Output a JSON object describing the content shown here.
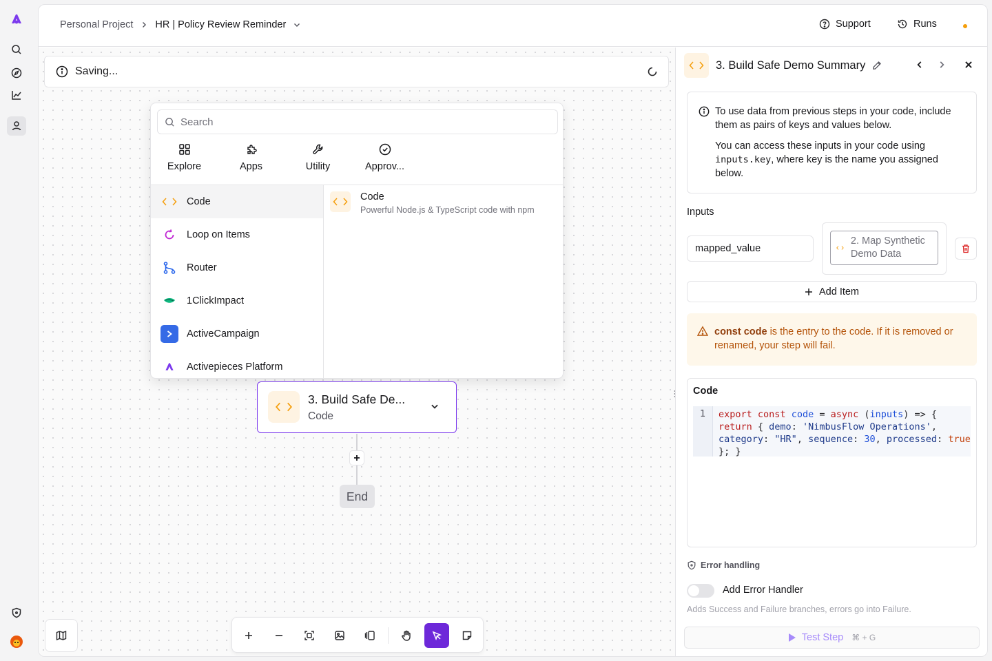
{
  "breadcrumb": {
    "project": "Personal Project",
    "flow": "HR | Policy Review Reminder"
  },
  "topbar": {
    "support": "Support",
    "runs": "Runs",
    "status_color": "#f59e0b"
  },
  "canvas": {
    "saving_text": "Saving...",
    "picker": {
      "search_placeholder": "Search",
      "tabs": [
        "Explore",
        "Apps",
        "Utility",
        "Approv..."
      ],
      "items": [
        "Code",
        "Loop on Items",
        "Router",
        "1ClickImpact",
        "ActiveCampaign",
        "Activepieces Platform"
      ],
      "detail": {
        "title": "Code",
        "subtitle": "Powerful Node.js & TypeScript code with npm"
      }
    },
    "node": {
      "title": "3. Build Safe De...",
      "subtitle": "Code"
    },
    "end_label": "End"
  },
  "panel": {
    "title": "3. Build Safe Demo Summary",
    "info_1": "To use data from previous steps in your code, include them as pairs of keys and values below.",
    "info_2_a": "You can access these inputs in your code using ",
    "info_2_code": "inputs.key",
    "info_2_b": ", where key is the name you assigned below.",
    "inputs_label": "Inputs",
    "input_key": "mapped_value",
    "input_value": "2. Map Synthetic Demo Data",
    "add_item": "Add Item",
    "warn_bold": "const code",
    "warn_rest": " is the entry to the code. If it is removed or renamed, your step will fail.",
    "code_title": "Code",
    "code_line_number": "1",
    "error_handling": "Error handling",
    "error_handler_label": "Add Error Handler",
    "error_handler_hint": "Adds Success and Failure branches, errors go into Failure.",
    "test_step": "Test Step",
    "test_shortcut": "⌘ + G"
  },
  "colors": {
    "accent": "#6d28d9",
    "code_icon": "#f59e0b",
    "warning_bg": "#fef7ea"
  }
}
